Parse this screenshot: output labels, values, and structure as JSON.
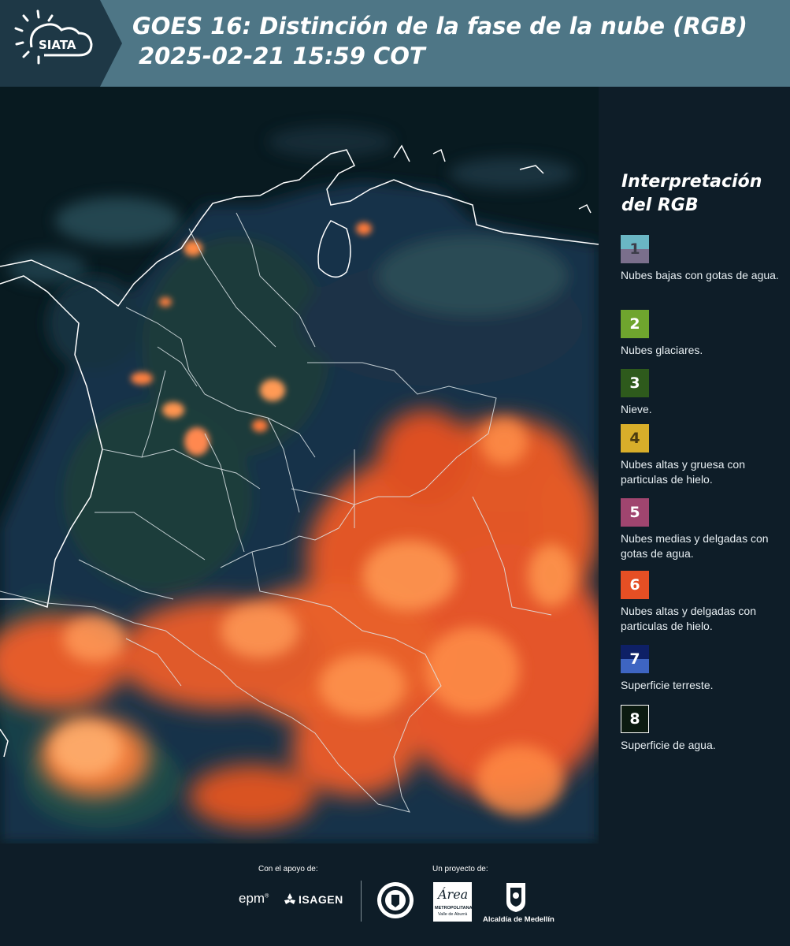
{
  "header": {
    "logo_text": "SIATA",
    "title_line1": "GOES 16: Distinción de la fase de la nube (RGB)",
    "title_line2": "2025-02-21 15:59 COT"
  },
  "legend": {
    "title": "Interpretación del RGB",
    "items": [
      {
        "num": "1",
        "label": "Nubes bajas con gotas de agua.",
        "color_top": "#6ab6c4",
        "color_bottom": "#7a6f8c"
      },
      {
        "num": "2",
        "label": "Nubes glaciares.",
        "color": "#6fa52e"
      },
      {
        "num": "3",
        "label": "Nieve.",
        "color": "#2e5a1c"
      },
      {
        "num": "4",
        "label": "Nubes altas y gruesa con particulas de hielo.",
        "color": "#d8ae2a"
      },
      {
        "num": "5",
        "label": "Nubes medias y delgadas con gotas de agua.",
        "color": "#a0456f"
      },
      {
        "num": "6",
        "label": "Nubes altas y delgadas con particulas de hielo.",
        "color": "#e54f24"
      },
      {
        "num": "7",
        "label": "Superficie terreste.",
        "color_top": "#0e2066",
        "color_bottom": "#3e65c2"
      },
      {
        "num": "8",
        "label": "Superficie de agua.",
        "color": "#0b1a10"
      }
    ]
  },
  "footer": {
    "support_label": "Con el apoyo de:",
    "project_label": "Un proyecto de:",
    "brand_epm": "epm",
    "brand_isagen": "ISAGEN",
    "brand_area_main": "Área",
    "brand_area_sub1": "METROPOLITANA",
    "brand_area_sub2": "Valle de Aburrá",
    "brand_alcaldia": "Alcaldía de Medellín"
  }
}
